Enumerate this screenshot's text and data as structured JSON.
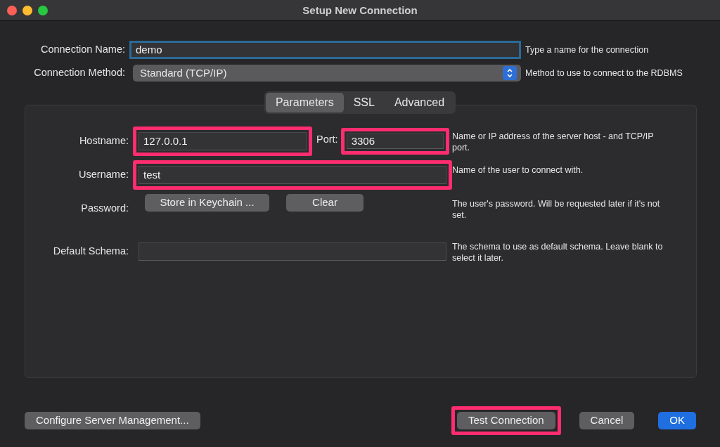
{
  "window": {
    "title": "Setup New Connection"
  },
  "top_fields": [
    {
      "kind": "input",
      "label": "Connection Name:",
      "value": "demo",
      "focused": true,
      "hint": "Type a name for the connection"
    },
    {
      "kind": "select",
      "label": "Connection Method:",
      "value": "Standard (TCP/IP)",
      "focused": false,
      "hint": "Method to use to connect to the RDBMS"
    }
  ],
  "tabs": [
    {
      "label": "Parameters",
      "selected": true
    },
    {
      "label": "SSL",
      "selected": false
    },
    {
      "label": "Advanced",
      "selected": false
    }
  ],
  "parameters": [
    {
      "kind": "host",
      "label": "Hostname:",
      "value": "127.0.0.1",
      "highlighted": true,
      "port_label": "Port:",
      "port_value": "3306",
      "port_highlighted": true,
      "hint": "Name or IP address of the server host - and TCP/IP port."
    },
    {
      "kind": "input",
      "label": "Username:",
      "value": "test",
      "highlighted": true,
      "hint": "Name of the user to connect with."
    },
    {
      "kind": "buttons",
      "label": "Password:",
      "buttons": [
        "Store in Keychain ...",
        "Clear"
      ],
      "hint": "The user's password. Will be requested later if it's not set."
    },
    {
      "kind": "input",
      "label": "Default Schema:",
      "highlighted": false,
      "hint": "The schema to use as default schema. Leave blank to select it later."
    }
  ],
  "footer_buttons": [
    {
      "label": "Configure Server Management...",
      "kind": "default",
      "highlighted": false
    },
    {
      "label": "Test Connection",
      "kind": "default",
      "highlighted": true
    },
    {
      "label": "Cancel",
      "kind": "default",
      "highlighted": false
    },
    {
      "label": "OK",
      "kind": "primary",
      "highlighted": false
    }
  ]
}
